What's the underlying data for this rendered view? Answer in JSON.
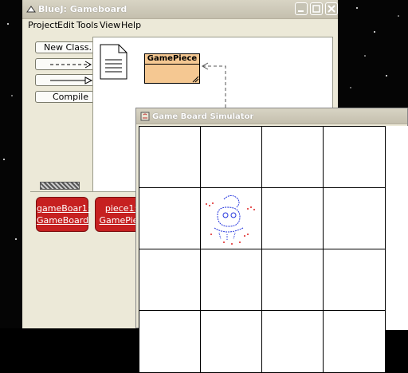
{
  "bluej": {
    "title": "BlueJ:  Gameboard",
    "menu": [
      "Project",
      "Edit",
      "Tools",
      "View",
      "Help"
    ],
    "buttons": {
      "new_class": "New Class...",
      "compile": "Compile"
    },
    "class_name": "GamePiece",
    "objects": [
      {
        "line1": "gameBoar1:",
        "line2": "GameBoard"
      },
      {
        "line1": "piece1:",
        "line2": "GamePiec"
      }
    ]
  },
  "board": {
    "title": "Game Board Simulator",
    "rows": 4,
    "cols": 4
  },
  "colors": {
    "class_fill": "#f5c892",
    "object_red": "#c62020",
    "window_bg": "#ece9d8"
  }
}
